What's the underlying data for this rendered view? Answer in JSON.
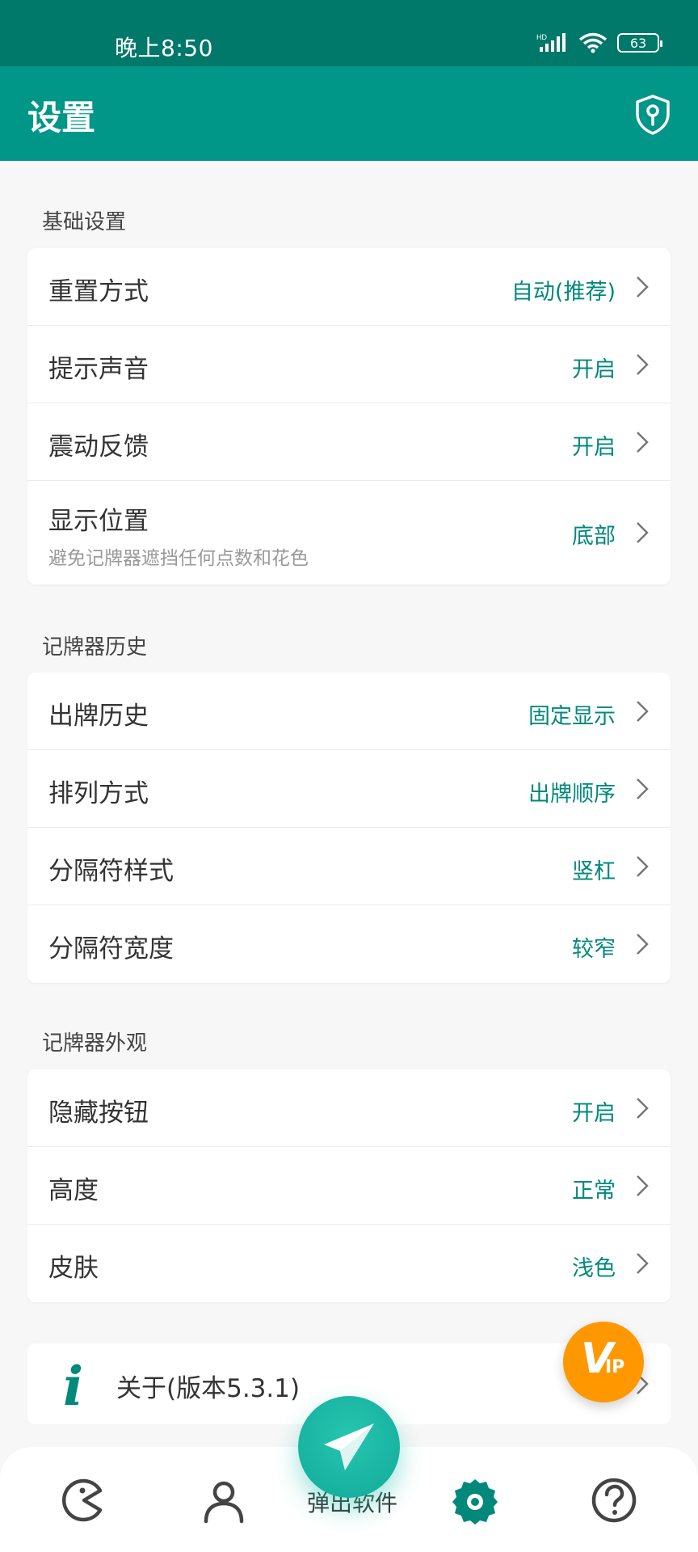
{
  "status_bar": {
    "time": "晚上8:50",
    "battery": "63",
    "network": "HD"
  },
  "header": {
    "title": "设置"
  },
  "sections": [
    {
      "title": "基础设置",
      "items": [
        {
          "label": "重置方式",
          "value": "自动(推荐)"
        },
        {
          "label": "提示声音",
          "value": "开启"
        },
        {
          "label": "震动反馈",
          "value": "开启"
        },
        {
          "label": "显示位置",
          "sub": "避免记牌器遮挡任何点数和花色",
          "value": "底部"
        }
      ]
    },
    {
      "title": "记牌器历史",
      "items": [
        {
          "label": "出牌历史",
          "value": "固定显示"
        },
        {
          "label": "排列方式",
          "value": "出牌顺序"
        },
        {
          "label": "分隔符样式",
          "value": "竖杠"
        },
        {
          "label": "分隔符宽度",
          "value": "较窄"
        }
      ]
    },
    {
      "title": "记牌器外观",
      "items": [
        {
          "label": "隐藏按钮",
          "value": "开启"
        },
        {
          "label": "高度",
          "value": "正常"
        },
        {
          "label": "皮肤",
          "value": "浅色"
        }
      ]
    }
  ],
  "about": {
    "icon_letter": "i",
    "label": "关于(版本5.3.1)"
  },
  "vip": {
    "v": "V",
    "ip": "IP"
  },
  "bottom_nav": {
    "partial_text": "弹出软件"
  },
  "colors": {
    "primary": "#009688",
    "status": "#00786a",
    "value": "#00897b",
    "vip": "#ff9800"
  },
  "icons": [
    "shield-key-icon",
    "chevron-right-icon",
    "info-icon",
    "pacman-icon",
    "person-icon",
    "paper-plane-icon",
    "gear-icon",
    "help-circle-icon",
    "signal-icon",
    "wifi-icon",
    "battery-icon"
  ]
}
